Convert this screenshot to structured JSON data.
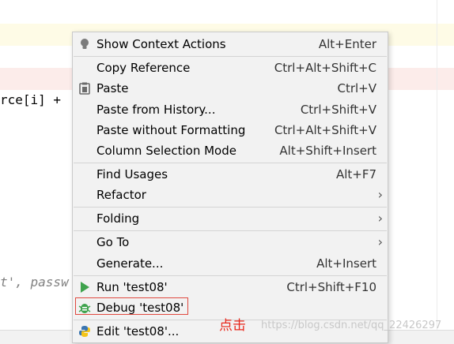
{
  "editor": {
    "code_line_1": "rce[i] +",
    "code_line_2": "t', passw"
  },
  "menu": {
    "items": [
      {
        "label": "Show Context Actions",
        "shortcut": "Alt+Enter",
        "icon": "lightbulb-icon"
      },
      {
        "label": "Copy Reference",
        "shortcut": "Ctrl+Alt+Shift+C"
      },
      {
        "label": "Paste",
        "shortcut": "Ctrl+V",
        "icon": "clipboard-icon"
      },
      {
        "label": "Paste from History...",
        "shortcut": "Ctrl+Shift+V"
      },
      {
        "label": "Paste without Formatting",
        "shortcut": "Ctrl+Alt+Shift+V"
      },
      {
        "label": "Column Selection Mode",
        "shortcut": "Alt+Shift+Insert"
      },
      {
        "label": "Find Usages",
        "shortcut": "Alt+F7"
      },
      {
        "label": "Refactor",
        "shortcut": "",
        "submenu": "›"
      },
      {
        "label": "Folding",
        "shortcut": "",
        "submenu": "›"
      },
      {
        "label": "Go To",
        "shortcut": "",
        "submenu": "›"
      },
      {
        "label": "Generate...",
        "shortcut": "Alt+Insert"
      },
      {
        "label": "Run 'test08'",
        "shortcut": "Ctrl+Shift+F10",
        "icon": "run-icon"
      },
      {
        "label": "Debug 'test08'",
        "shortcut": "",
        "icon": "debug-icon"
      },
      {
        "label": "Edit 'test08'...",
        "shortcut": "",
        "icon": "python-icon"
      }
    ]
  },
  "annotation": "点击",
  "watermark": "https://blog.csdn.net/qq_22426297",
  "colors": {
    "menu_bg": "#f2f2f2",
    "highlight_box": "#e0483e",
    "annotation": "#e8271b",
    "run_green": "#3fa34d"
  }
}
